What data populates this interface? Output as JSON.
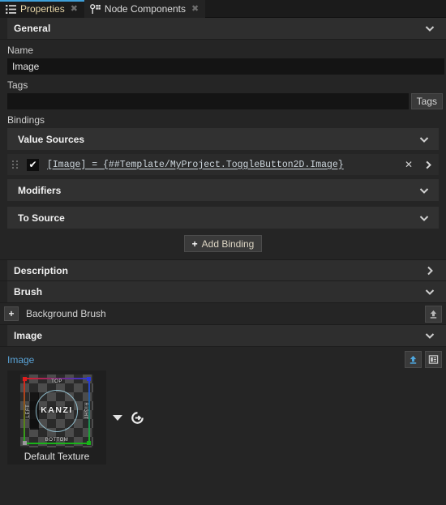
{
  "tabs": [
    {
      "label": "Properties",
      "icon": "list-icon",
      "active": true,
      "close": "✖"
    },
    {
      "label": "Node Components",
      "icon": "node-components-icon",
      "active": false,
      "close": "✖"
    }
  ],
  "sections": {
    "general": {
      "title": "General",
      "chevron": "❯"
    },
    "description": {
      "title": "Description",
      "chevron": "❯"
    },
    "brush": {
      "title": "Brush",
      "chevron": "❯"
    },
    "image": {
      "title": "Image",
      "chevron": "❯"
    }
  },
  "general": {
    "name_label": "Name",
    "name_value": "Image",
    "tags_label": "Tags",
    "tags_value": "",
    "tags_button": "Tags",
    "bindings_label": "Bindings"
  },
  "bindings": {
    "value_sources": {
      "title": "Value Sources",
      "chevron": "❯"
    },
    "modifiers": {
      "title": "Modifiers",
      "chevron": "❯"
    },
    "to_source": {
      "title": "To Source",
      "chevron": "❯"
    },
    "rows": [
      {
        "enabled": true,
        "check_glyph": "✔",
        "expression": "[Image] = {##Template/MyProject.ToggleButton2D.Image}",
        "remove_glyph": "✕",
        "expand_glyph": "❯"
      }
    ],
    "add_binding": {
      "label": "Add Binding",
      "plus": "+"
    }
  },
  "brush": {
    "background_brush_label": "Background Brush",
    "add_glyph": "+",
    "upload_icon": "upload-icon"
  },
  "image_property": {
    "label": "Image",
    "upload_icon": "upload-icon",
    "properties_icon": "properties-panel-icon",
    "texture_name": "Default Texture",
    "texture_watermark": "KANZI",
    "texture_edges": {
      "top": "TOP",
      "bottom": "BOTTOM",
      "left": "LEFT",
      "right": "RIGHT"
    },
    "dropdown_icon": "chevron-down-icon",
    "reset_icon": "reset-icon"
  },
  "colors": {
    "accent_blue": "#3e9fd8",
    "active_tab_text": "#e8d7a8",
    "link_blue": "#5aa4d8",
    "panel_bg": "#252525",
    "header_bg": "#2e2e2e",
    "input_bg": "#141414"
  }
}
